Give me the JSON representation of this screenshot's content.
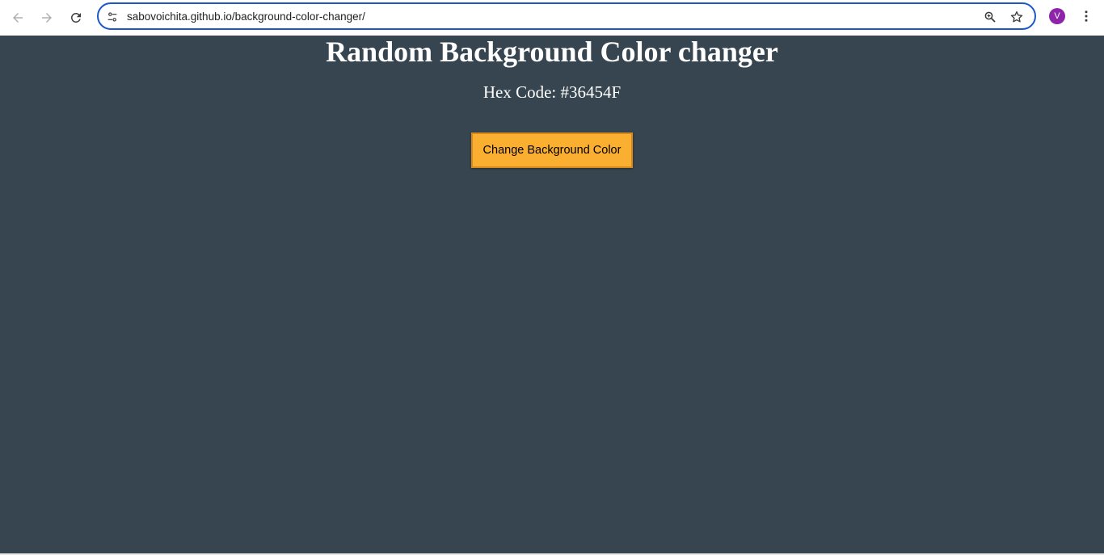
{
  "browser": {
    "url": "sabovoichita.github.io/background-color-changer/",
    "avatar_letter": "V",
    "icons": {
      "back": "arrow-left-icon",
      "forward": "arrow-right-icon",
      "reload": "reload-icon",
      "site_info": "tune-icon",
      "zoom": "zoom-in-icon",
      "bookmark": "star-icon",
      "menu": "kebab-menu-icon"
    }
  },
  "page": {
    "title": "Random Background Color changer",
    "hex_line": "Hex Code: #36454F",
    "button_label": "Change Background Color",
    "background_color": "#36454F",
    "button_color": "#FBAF30"
  }
}
